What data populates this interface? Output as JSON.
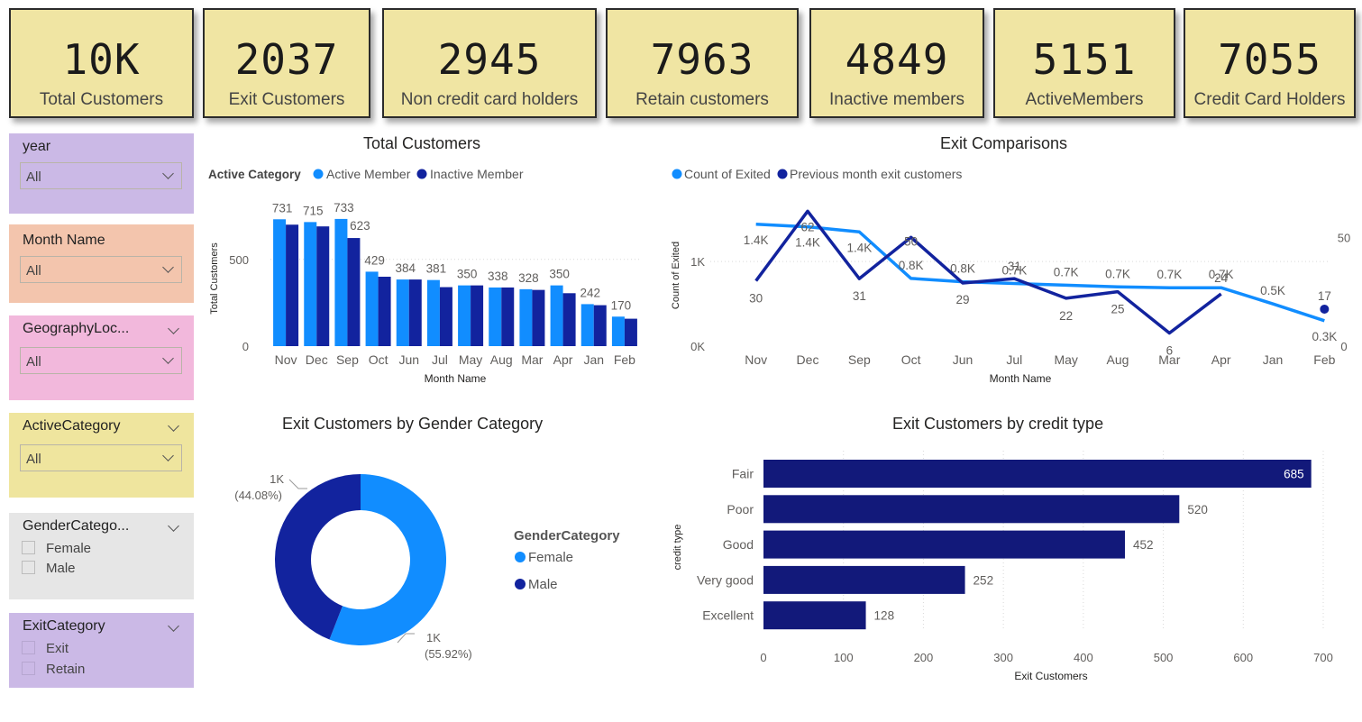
{
  "kpis": [
    {
      "value": "10K",
      "label": "Total Customers"
    },
    {
      "value": "2037",
      "label": "Exit Customers"
    },
    {
      "value": "2945",
      "label": "Non credit card holders"
    },
    {
      "value": "7963",
      "label": "Retain customers"
    },
    {
      "value": "4849",
      "label": "Inactive members"
    },
    {
      "value": "5151",
      "label": "ActiveMembers"
    },
    {
      "value": "7055",
      "label": "Credit Card Holders"
    }
  ],
  "slicers": {
    "year": {
      "title": "year",
      "value": "All",
      "color": "#cbb9e6"
    },
    "month": {
      "title": "Month Name",
      "value": "All",
      "color": "#f3c5ad"
    },
    "geography": {
      "title": "GeographyLoc...",
      "value": "All",
      "color": "#f2b8dc"
    },
    "active": {
      "title": "ActiveCategory",
      "value": "All",
      "color": "#efe59e"
    },
    "gender": {
      "title": "GenderCatego...",
      "options": [
        "Female",
        "Male"
      ],
      "color": "#e6e6e6"
    },
    "exit": {
      "title": "ExitCategory",
      "options": [
        "Exit",
        "Retain"
      ],
      "color": "#cbb9e6"
    }
  },
  "chart_data": [
    {
      "type": "bar",
      "title": "Total Customers",
      "legend_title": "Active Category",
      "xlabel": "Month Name",
      "ylabel": "Total Customers",
      "categories": [
        "Nov",
        "Dec",
        "Sep",
        "Oct",
        "Jun",
        "Jul",
        "May",
        "Aug",
        "Mar",
        "Apr",
        "Jan",
        "Feb"
      ],
      "series": [
        {
          "name": "Active Member",
          "color": "#118dff",
          "values": [
            731,
            715,
            733,
            429,
            384,
            381,
            350,
            338,
            328,
            350,
            242,
            170
          ]
        },
        {
          "name": "Inactive Member",
          "color": "#12239e",
          "values": [
            700,
            690,
            623,
            400,
            384,
            340,
            350,
            338,
            324,
            305,
            236,
            158
          ]
        }
      ],
      "data_labels": [
        "731",
        "715",
        "733",
        "623",
        "429",
        "384",
        "381",
        "350",
        "338",
        "328",
        "350",
        "242",
        "170"
      ],
      "yticks": [
        "0",
        "500"
      ],
      "ylim": [
        0,
        800
      ],
      "legend_position": "top-left"
    },
    {
      "type": "line",
      "title": "Exit Comparisons",
      "xlabel": "Month Name",
      "ylabel": "Count of Exited",
      "categories": [
        "Nov",
        "Dec",
        "Sep",
        "Oct",
        "Jun",
        "Jul",
        "May",
        "Aug",
        "Mar",
        "Apr",
        "Jan",
        "Feb"
      ],
      "series": [
        {
          "name": "Count of Exited",
          "color": "#118dff",
          "axis": "left",
          "values": [
            1.44,
            1.41,
            1.35,
            0.8,
            0.76,
            0.74,
            0.72,
            0.7,
            0.69,
            0.69,
            0.5,
            0.3
          ],
          "labels": [
            "1.4K",
            "1.4K",
            "1.4K",
            "0.8K",
            "0.8K",
            "0.7K",
            "0.7K",
            "0.7K",
            "0.7K",
            "0.7K",
            "0.5K",
            "0.3K"
          ]
        },
        {
          "name": "Previous month exit customers",
          "color": "#12239e",
          "axis": "right",
          "values": [
            30,
            62,
            31,
            50,
            29,
            31,
            22,
            25,
            6,
            24,
            null,
            17
          ],
          "labels": [
            "30",
            "62",
            "31",
            "50",
            "29",
            "31",
            "22",
            "25",
            "6",
            "24",
            "",
            "17"
          ]
        }
      ],
      "yticks_left": [
        "0K",
        "1K"
      ],
      "yticks_right": [
        "0",
        "50"
      ],
      "ylim_left": [
        0,
        1.8
      ],
      "ylim_right": [
        0,
        70
      ],
      "legend_position": "top-left"
    },
    {
      "type": "pie",
      "title": "Exit Customers by Gender Category",
      "legend_title": "GenderCategory",
      "slices": [
        {
          "name": "Female",
          "value": 55.92,
          "color": "#118dff",
          "label": "1K",
          "pct": "(55.92%)"
        },
        {
          "name": "Male",
          "value": 44.08,
          "color": "#12239e",
          "label": "1K",
          "pct": "(44.08%)"
        }
      ]
    },
    {
      "type": "bar",
      "orientation": "horizontal",
      "title": "Exit Customers by credit type",
      "xlabel": "Exit Customers",
      "ylabel": "credit type",
      "categories": [
        "Fair",
        "Poor",
        "Good",
        "Very good",
        "Excellent"
      ],
      "values": [
        685,
        520,
        452,
        252,
        128
      ],
      "color": "#12197a",
      "xticks": [
        "0",
        "100",
        "200",
        "300",
        "400",
        "500",
        "600",
        "700"
      ],
      "xlim": [
        0,
        700
      ]
    }
  ]
}
